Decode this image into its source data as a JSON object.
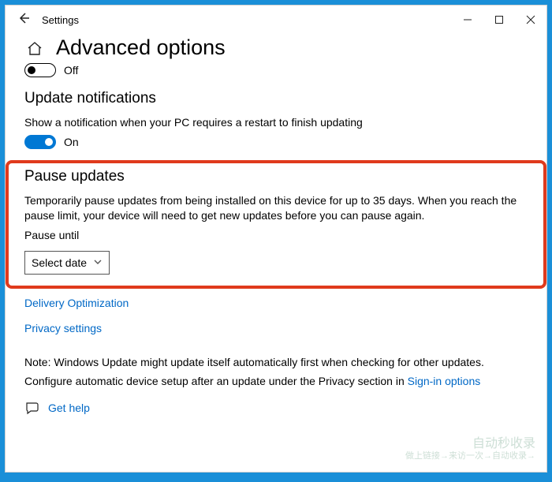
{
  "window": {
    "title": "Settings"
  },
  "page": {
    "title": "Advanced options"
  },
  "topToggle": {
    "label": "Off"
  },
  "sections": {
    "notifications": {
      "title": "Update notifications",
      "desc": "Show a notification when your PC requires a restart to finish updating",
      "toggleLabel": "On"
    },
    "pause": {
      "title": "Pause updates",
      "desc": "Temporarily pause updates from being installed on this device for up to 35 days. When you reach the pause limit, your device will need to get new updates before you can pause again.",
      "untilLabel": "Pause until",
      "selectPlaceholder": "Select date"
    }
  },
  "links": {
    "delivery": "Delivery Optimization",
    "privacy": "Privacy settings",
    "signin": "Sign-in options",
    "gethelp": "Get help"
  },
  "notes": {
    "note1": "Note: Windows Update might update itself automatically first when checking for other updates.",
    "note2_prefix": "Configure automatic device setup after an update under the Privacy section in "
  },
  "watermark": {
    "line1": "自动秒收录",
    "line2": "做上链接→来访一次→自动收录→"
  }
}
